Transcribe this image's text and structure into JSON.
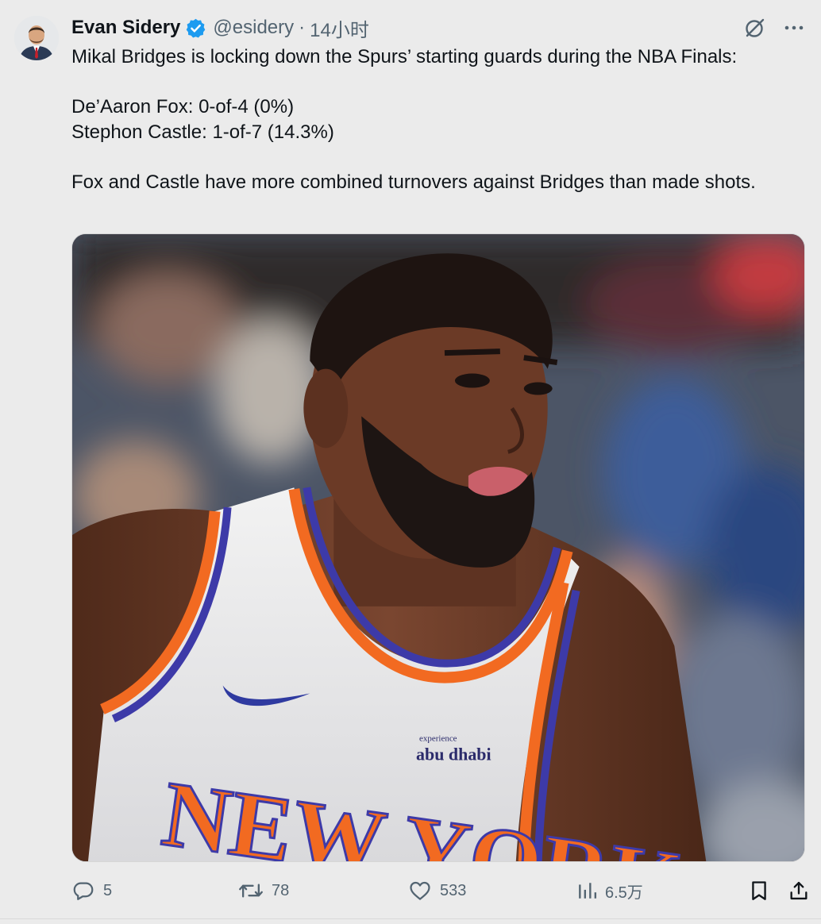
{
  "author": {
    "display_name": "Evan Sidery",
    "handle": "@esidery",
    "separator": "·",
    "time": "14小时",
    "verified": true,
    "verified_color": "#1d9bf0"
  },
  "tweet": {
    "line1": "Mikal Bridges is locking down the Spurs’ starting guards during the NBA Finals:",
    "line2": "De’Aaron Fox: 0-of-4 (0%)",
    "line3": "Stephon Castle: 1-of-7 (14.3%)",
    "line4": "Fox and Castle have more combined turnovers against Bridges than made shots."
  },
  "media": {
    "jersey_text": "NEW YORK",
    "sponsor_small": "experience",
    "sponsor": "abu dhabi"
  },
  "actions": {
    "replies": "5",
    "retweets": "78",
    "likes": "533",
    "views": "6.5万"
  },
  "icons": {
    "grok": "grok-icon",
    "more": "more-icon",
    "reply": "reply-icon",
    "retweet": "retweet-icon",
    "like": "heart-icon",
    "views": "views-icon",
    "bookmark": "bookmark-icon",
    "share": "share-icon"
  },
  "colors": {
    "text": "#0f1419",
    "secondary": "#536471",
    "background": "#ebebeb",
    "knicks_orange": "#f26a21",
    "knicks_blue": "#3d3aa8"
  }
}
